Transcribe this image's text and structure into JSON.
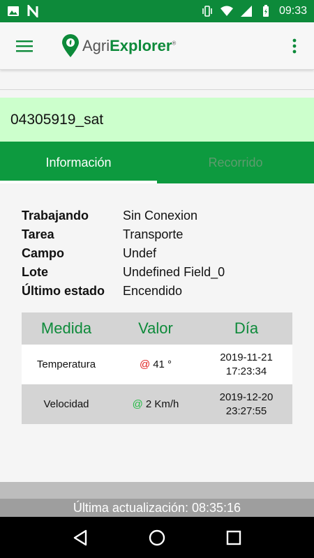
{
  "status_bar": {
    "time": "09:33"
  },
  "app": {
    "logo_prefix": "Agri",
    "logo_bold": "Explorer",
    "logo_tm": "®"
  },
  "device": {
    "name": "04305919_sat"
  },
  "tabs": [
    {
      "label": "Información",
      "active": true
    },
    {
      "label": "Recorrido",
      "active": false
    }
  ],
  "info": [
    {
      "key": "Trabajando",
      "value": "Sin Conexion"
    },
    {
      "key": "Tarea",
      "value": "Transporte"
    },
    {
      "key": "Campo",
      "value": "Undef"
    },
    {
      "key": "Lote",
      "value": "Undefined Field_0"
    },
    {
      "key": "Último estado",
      "value": "Encendido"
    }
  ],
  "table": {
    "headers": [
      "Medida",
      "Valor",
      "Día"
    ],
    "rows": [
      {
        "medida": "Temperatura",
        "at": "@",
        "at_color": "#e02020",
        "valor": "41 °",
        "dia_date": "2019-11-21",
        "dia_time": "17:23:34"
      },
      {
        "medida": "Velocidad",
        "at": "@",
        "at_color": "#22bb44",
        "valor": "2 Km/h",
        "dia_date": "2019-12-20",
        "dia_time": "23:27:55"
      }
    ]
  },
  "footer": {
    "last_update": "Última actualización: 08:35:16"
  },
  "colors": {
    "primary": "#0d8a3a",
    "tab_bg": "#0d9a3f",
    "header_bg": "#ccffcc"
  },
  "icons": [
    "image-icon",
    "n-icon",
    "vibrate-icon",
    "wifi-icon",
    "signal-icon",
    "battery-icon",
    "menu-icon",
    "map-pin-logo-icon",
    "more-vert-icon",
    "back-icon",
    "home-icon",
    "recents-icon"
  ]
}
